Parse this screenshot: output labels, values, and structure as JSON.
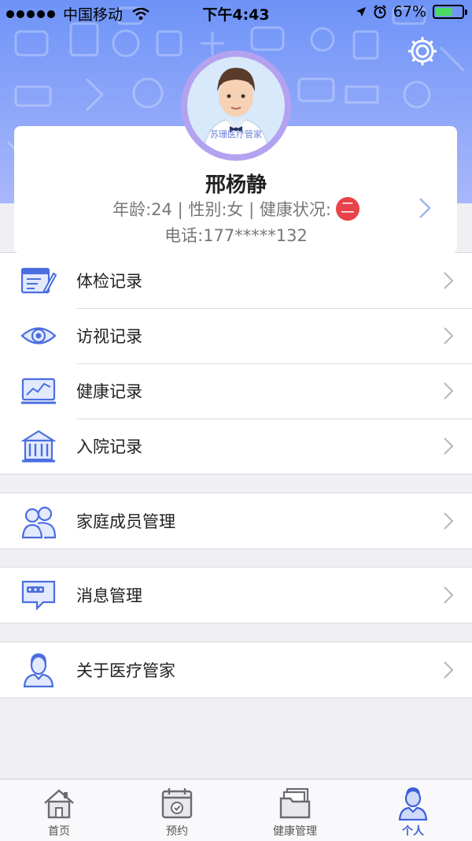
{
  "status_bar": {
    "carrier": "中国移动",
    "time": "下午4:43",
    "battery": "67%",
    "battery_level": 0.67
  },
  "profile": {
    "avatar_caption": "苏珊医疗管家",
    "name": "邢杨静",
    "info_text": "年龄:24 | 性别:女 | 健康状况:",
    "health_badge": "二",
    "phone": "电话:177*****132"
  },
  "menu_sections": [
    [
      {
        "label": "体检记录",
        "icon": "checkup-record-icon"
      },
      {
        "label": "访视记录",
        "icon": "eye-icon"
      },
      {
        "label": "健康记录",
        "icon": "health-chart-icon"
      },
      {
        "label": "入院记录",
        "icon": "hospital-icon"
      }
    ],
    [
      {
        "label": "家庭成员管理",
        "icon": "family-icon"
      }
    ],
    [
      {
        "label": "消息管理",
        "icon": "message-icon"
      }
    ],
    [
      {
        "label": "关于医疗管家",
        "icon": "doctor-icon"
      }
    ]
  ],
  "tabs": [
    {
      "label": "首页",
      "icon": "home-icon"
    },
    {
      "label": "预约",
      "icon": "calendar-icon"
    },
    {
      "label": "健康管理",
      "icon": "folder-icon"
    },
    {
      "label": "个人",
      "icon": "person-icon",
      "active": true
    }
  ],
  "colors": {
    "accent": "#3c5fd8",
    "header": "#8fa7f9",
    "badge": "#e8424a",
    "icon": "#4a6ee0"
  }
}
